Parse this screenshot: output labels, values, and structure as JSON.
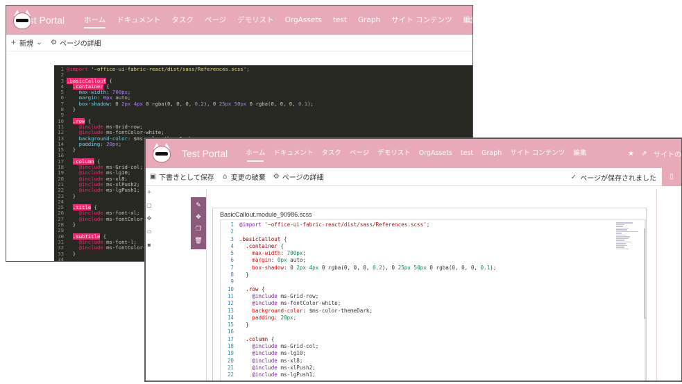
{
  "window1": {
    "site_title": "Test Portal",
    "nav": [
      "ホーム",
      "ドキュメント",
      "タスク",
      "ページ",
      "デモリスト",
      "OrgAssets",
      "test",
      "Graph",
      "サイト コンテンツ",
      "編集"
    ],
    "active_nav": 0,
    "cmd": {
      "new": "新規",
      "page_details": "ページの詳細"
    },
    "code": [
      {
        "n": "1",
        "t": "@import '~office-ui-fabric-react/dist/sass/References.scss';"
      },
      {
        "n": "2",
        "t": ""
      },
      {
        "n": "3",
        "t": ".basicCallout {"
      },
      {
        "n": "4",
        "t": "  .container {"
      },
      {
        "n": "5",
        "t": "    max-width: 700px;"
      },
      {
        "n": "6",
        "t": "    margin: 0px auto;"
      },
      {
        "n": "7",
        "t": "    box-shadow: 0 2px 4px 0 rgba(0, 0, 0, 0.2), 0 25px 50px 0 rgba(0, 0, 0, 0.1);"
      },
      {
        "n": "8",
        "t": "  }"
      },
      {
        "n": "9",
        "t": ""
      },
      {
        "n": "10",
        "t": "  .row {"
      },
      {
        "n": "11",
        "t": "    @include ms-Grid-row;"
      },
      {
        "n": "12",
        "t": "    @include ms-fontColor-white;"
      },
      {
        "n": "13",
        "t": "    background-color: $ms-color-themeDark;"
      },
      {
        "n": "14",
        "t": "    padding: 20px;"
      },
      {
        "n": "15",
        "t": "  }"
      },
      {
        "n": "16",
        "t": ""
      },
      {
        "n": "17",
        "t": "  .column {"
      },
      {
        "n": "18",
        "t": "    @include ms-Grid-col;"
      },
      {
        "n": "19",
        "t": "    @include ms-lg10;"
      },
      {
        "n": "20",
        "t": "    @include ms-xl8;"
      },
      {
        "n": "21",
        "t": "    @include ms-xlPush2;"
      },
      {
        "n": "22",
        "t": "    @include ms-lgPush1;"
      },
      {
        "n": "23",
        "t": "  }"
      },
      {
        "n": "24",
        "t": ""
      },
      {
        "n": "25",
        "t": "  .title {"
      },
      {
        "n": "26",
        "t": "    @include ms-font-xl;"
      },
      {
        "n": "27",
        "t": "    @include ms-fontColor-white;"
      },
      {
        "n": "28",
        "t": "  }"
      },
      {
        "n": "29",
        "t": ""
      },
      {
        "n": "30",
        "t": "  .subTitle {"
      },
      {
        "n": "31",
        "t": "    @include ms-font-l;"
      },
      {
        "n": "32",
        "t": "    @include ms-fontColor-white;"
      },
      {
        "n": "33",
        "t": "  }"
      },
      {
        "n": "34",
        "t": ""
      }
    ]
  },
  "window2": {
    "site_title": "Test Portal",
    "nav": [
      "ホーム",
      "ドキュメント",
      "タスク",
      "ページ",
      "デモリスト",
      "OrgAssets",
      "test",
      "Graph",
      "サイト コンテンツ",
      "編集"
    ],
    "active_nav": 0,
    "suite_right_text": "サイトの",
    "cmd": {
      "save_draft": "下書きとして保存",
      "discard": "変更の破棄",
      "page_details": "ページの詳細",
      "saved_status": "ページが保存されました"
    },
    "editor": {
      "filename": "BasicCallout.module_90986.scss",
      "lines": [
        {
          "n": "1",
          "t": "@import '~office-ui-fabric-react/dist/sass/References.scss';"
        },
        {
          "n": "2",
          "t": ""
        },
        {
          "n": "3",
          "t": ".basicCallout {"
        },
        {
          "n": "4",
          "t": "  .container {"
        },
        {
          "n": "5",
          "t": "    max-width: 700px;"
        },
        {
          "n": "6",
          "t": "    margin: 0px auto;"
        },
        {
          "n": "7",
          "t": "    box-shadow: 0 2px 4px 0 rgba(0, 0, 0, 0.2), 0 25px 50px 0 rgba(0, 0, 0, 0.1);"
        },
        {
          "n": "8",
          "t": "  }"
        },
        {
          "n": "9",
          "t": ""
        },
        {
          "n": "10",
          "t": "  .row {"
        },
        {
          "n": "11",
          "t": "    @include ms-Grid-row;"
        },
        {
          "n": "12",
          "t": "    @include ms-fontColor-white;"
        },
        {
          "n": "13",
          "t": "    background-color: $ms-color-themeDark;"
        },
        {
          "n": "14",
          "t": "    padding: 20px;"
        },
        {
          "n": "15",
          "t": "  }"
        },
        {
          "n": "16",
          "t": ""
        },
        {
          "n": "17",
          "t": "  .column {"
        },
        {
          "n": "18",
          "t": "    @include ms-Grid-col;"
        },
        {
          "n": "19",
          "t": "    @include ms-lg10;"
        },
        {
          "n": "20",
          "t": "    @include ms-xl8;"
        },
        {
          "n": "21",
          "t": "    @include ms-xlPush2;"
        },
        {
          "n": "22",
          "t": "    @include ms-lgPush1;"
        }
      ]
    }
  },
  "colors": {
    "suitebar": "#e8aab9",
    "dark_editor_bg": "#272822",
    "toolbar": "#8c5a7a"
  }
}
